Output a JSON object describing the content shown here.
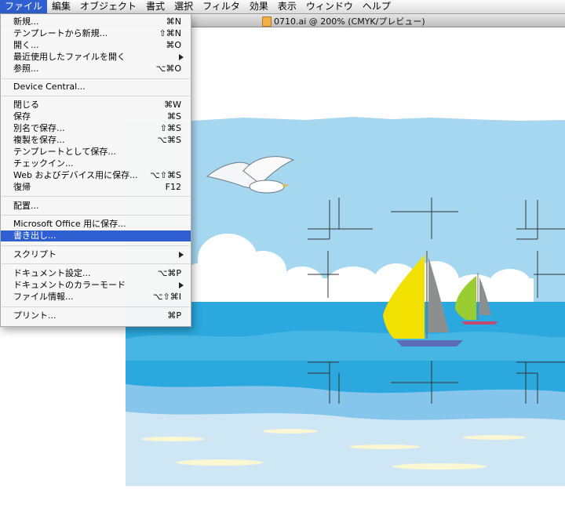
{
  "menubar": {
    "items": [
      "ファイル",
      "編集",
      "オブジェクト",
      "書式",
      "選択",
      "フィルタ",
      "効果",
      "表示",
      "ウィンドウ",
      "ヘルプ"
    ]
  },
  "document": {
    "title": "0710.ai @ 200% (CMYK/プレビュー)"
  },
  "file_menu": {
    "items": [
      {
        "label": "新規...",
        "shortcut": "⌘N"
      },
      {
        "label": "テンプレートから新規...",
        "shortcut": "⇧⌘N"
      },
      {
        "label": "開く...",
        "shortcut": "⌘O"
      },
      {
        "label": "最近使用したファイルを開く",
        "shortcut": ""
      },
      {
        "label": "参照...",
        "shortcut": "⌥⌘O"
      },
      {
        "label": "Device Central...",
        "shortcut": ""
      },
      {
        "label": "閉じる",
        "shortcut": "⌘W"
      },
      {
        "label": "保存",
        "shortcut": "⌘S"
      },
      {
        "label": "別名で保存...",
        "shortcut": "⇧⌘S"
      },
      {
        "label": "複製を保存...",
        "shortcut": "⌥⌘S"
      },
      {
        "label": "テンプレートとして保存...",
        "shortcut": ""
      },
      {
        "label": "チェックイン...",
        "shortcut": ""
      },
      {
        "label": "Web およびデバイス用に保存...",
        "shortcut": "⌥⇧⌘S"
      },
      {
        "label": "復帰",
        "shortcut": "F12"
      },
      {
        "label": "配置...",
        "shortcut": ""
      },
      {
        "label": "Microsoft Office 用に保存...",
        "shortcut": ""
      },
      {
        "label": "書き出し...",
        "shortcut": ""
      },
      {
        "label": "スクリプト",
        "shortcut": ""
      },
      {
        "label": "ドキュメント設定...",
        "shortcut": "⌥⌘P"
      },
      {
        "label": "ドキュメントのカラーモード",
        "shortcut": ""
      },
      {
        "label": "ファイル情報...",
        "shortcut": "⌥⇧⌘I"
      },
      {
        "label": "プリント...",
        "shortcut": "⌘P"
      }
    ]
  },
  "colors": {
    "accent": "#2f5fd0",
    "sky": "#a6d7f0",
    "sea": "#2ba8de",
    "sail_yellow": "#f2e000",
    "sail_green": "#9acd32"
  }
}
